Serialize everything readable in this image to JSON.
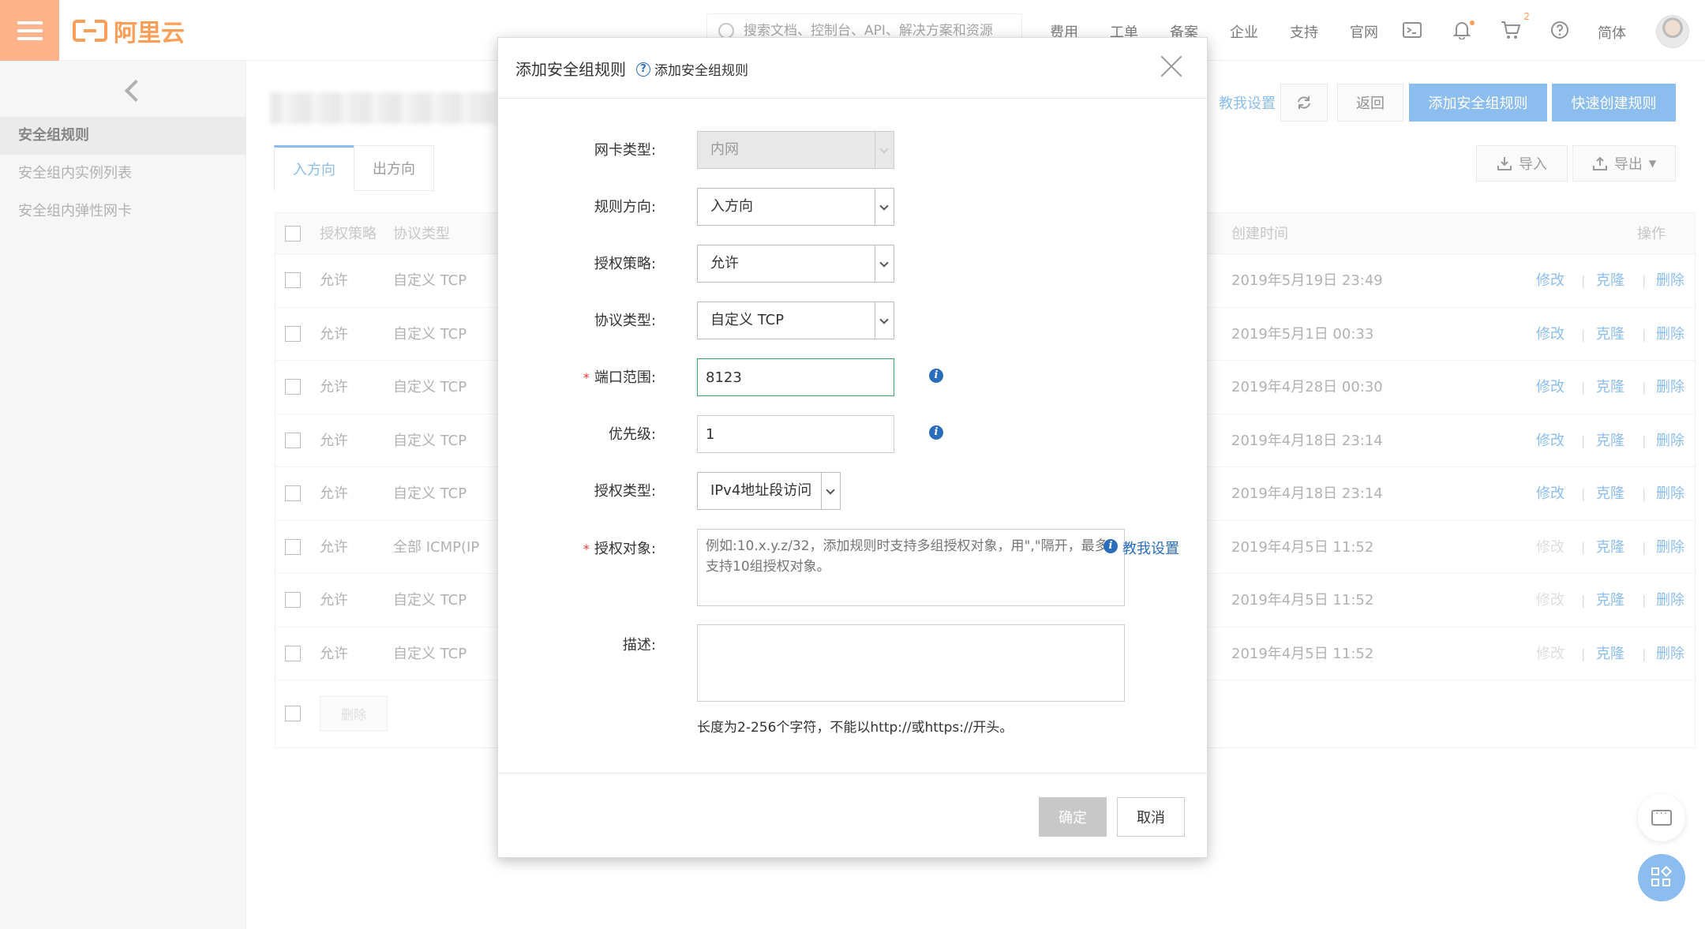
{
  "topbar": {
    "logo_text": "阿里云",
    "search_placeholder": "搜索文档、控制台、API、解决方案和资源",
    "nav": [
      "费用",
      "工单",
      "备案",
      "企业",
      "支持",
      "官网"
    ],
    "cart_badge": "2",
    "language": "简体"
  },
  "sidebar": {
    "items": [
      "安全组规则",
      "安全组内实例列表",
      "安全组内弹性网卡"
    ],
    "active_index": 0
  },
  "toolbar": {
    "teach_link": "教我设置",
    "back_label": "返回",
    "add_rule_label": "添加安全组规则",
    "quick_create_label": "快速创建规则",
    "import_label": "导入",
    "export_label": "导出"
  },
  "tabs": [
    "入方向",
    "出方向"
  ],
  "table": {
    "headers": {
      "policy": "授权策略",
      "protocol": "协议类型",
      "created": "创建时间",
      "actions": "操作"
    },
    "rows": [
      {
        "policy": "允许",
        "protocol": "自定义 TCP",
        "created": "2019年5月19日 23:49",
        "edit_disabled": false
      },
      {
        "policy": "允许",
        "protocol": "自定义 TCP",
        "created": "2019年5月1日 00:33",
        "edit_disabled": false
      },
      {
        "policy": "允许",
        "protocol": "自定义 TCP",
        "created": "2019年4月28日 00:30",
        "edit_disabled": false
      },
      {
        "policy": "允许",
        "protocol": "自定义 TCP",
        "created": "2019年4月18日 23:14",
        "edit_disabled": false
      },
      {
        "policy": "允许",
        "protocol": "自定义 TCP",
        "created": "2019年4月18日 23:14",
        "edit_disabled": false
      },
      {
        "policy": "允许",
        "protocol": "全部 ICMP(IP",
        "created": "2019年4月5日 11:52",
        "edit_disabled": true
      },
      {
        "policy": "允许",
        "protocol": "自定义 TCP",
        "created": "2019年4月5日 11:52",
        "edit_disabled": true
      },
      {
        "policy": "允许",
        "protocol": "自定义 TCP",
        "created": "2019年4月5日 11:52",
        "edit_disabled": true
      }
    ],
    "row_actions": {
      "edit": "修改",
      "clone": "克隆",
      "delete": "删除",
      "separator": "|"
    },
    "batch_delete_label": "删除"
  },
  "modal": {
    "title": "添加安全组规则",
    "help_link": "添加安全组规则",
    "fields": {
      "nic_type": {
        "label": "网卡类型:",
        "value": "内网"
      },
      "direction": {
        "label": "规则方向:",
        "value": "入方向"
      },
      "policy": {
        "label": "授权策略:",
        "value": "允许"
      },
      "protocol": {
        "label": "协议类型:",
        "value": "自定义 TCP"
      },
      "port_range": {
        "label": "端口范围:",
        "value": "8123"
      },
      "priority": {
        "label": "优先级:",
        "value": "1"
      },
      "auth_type": {
        "label": "授权类型:",
        "value": "IPv4地址段访问"
      },
      "auth_object": {
        "label": "授权对象:",
        "placeholder": "例如:10.x.y.z/32，添加规则时支持多组授权对象，用\",\"隔开，最多支持10组授权对象。",
        "teach_link": "教我设置"
      },
      "description": {
        "label": "描述:",
        "hint": "长度为2-256个字符，不能以http://或https://开头。"
      }
    },
    "confirm_label": "确定",
    "cancel_label": "取消"
  }
}
